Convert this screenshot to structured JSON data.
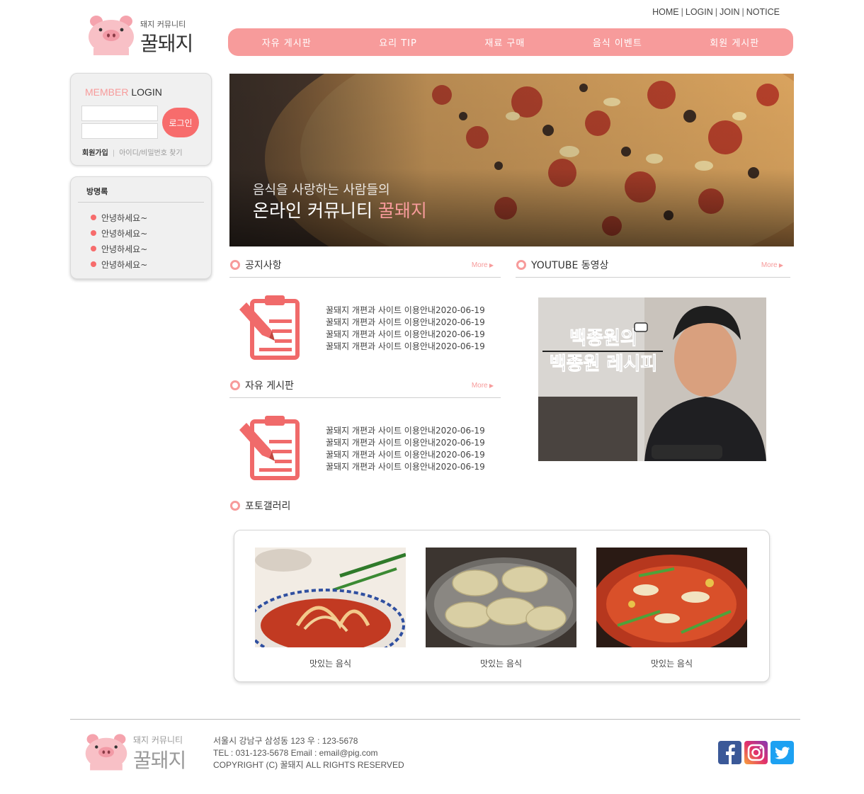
{
  "brand": {
    "sub": "돼지 커뮤니티",
    "name": "꿀돼지"
  },
  "top_links": [
    "HOME",
    "LOGIN",
    "JOIN",
    "NOTICE"
  ],
  "nav": [
    "자유 게시판",
    "요리 TIP",
    "재료 구매",
    "음식 이벤트",
    "회원 게시판"
  ],
  "login": {
    "title_accent": "MEMBER",
    "title_main": "LOGIN",
    "button": "로그인",
    "join": "회원가입",
    "find": "아이디/비밀번호 찾기"
  },
  "guestbook": {
    "title": "방명록",
    "items": [
      "안녕하세요~",
      "안녕하세요~",
      "안녕하세요~",
      "안녕하세요~"
    ]
  },
  "hero": {
    "subtitle": "음식을 사랑하는 사람들의",
    "title_main": "온라인 커뮤니티 ",
    "title_brand": "꿀돼지"
  },
  "notice": {
    "title": "공지사항",
    "more": "More",
    "rows": [
      "꿀돼지 개편과 사이트 이용안내2020-06-19",
      "꿀돼지 개편과 사이트 이용안내2020-06-19",
      "꿀돼지 개편과 사이트 이용안내2020-06-19",
      "꿀돼지 개편과 사이트 이용안내2020-06-19"
    ]
  },
  "free_board": {
    "title": "자유 게시판",
    "more": "More",
    "rows": [
      "꿀돼지 개편과 사이트 이용안내2020-06-19",
      "꿀돼지 개편과 사이트 이용안내2020-06-19",
      "꿀돼지 개편과 사이트 이용안내2020-06-19",
      "꿀돼지 개편과 사이트 이용안내2020-06-19"
    ]
  },
  "youtube": {
    "title": "YOUTUBE 동영상",
    "more": "More",
    "thumb_line1": "백종원의",
    "thumb_line2": "백종원 레시피"
  },
  "gallery": {
    "title": "포토갤러리",
    "items": [
      "맛있는 음식",
      "맛있는 음식",
      "맛있는 음식"
    ]
  },
  "footer": {
    "address": "서울시 강남구 삼성동 123 우 : 123-5678",
    "contact": "TEL : 031-123-5678 Email : email@pig.com",
    "copyright": "COPYRIGHT (C) 꿀돼지 ALL RIGHTS RESERVED"
  },
  "social": [
    "facebook-icon",
    "instagram-icon",
    "twitter-icon"
  ],
  "colors": {
    "accent": "#f79b9b",
    "button": "#f76c6c"
  }
}
